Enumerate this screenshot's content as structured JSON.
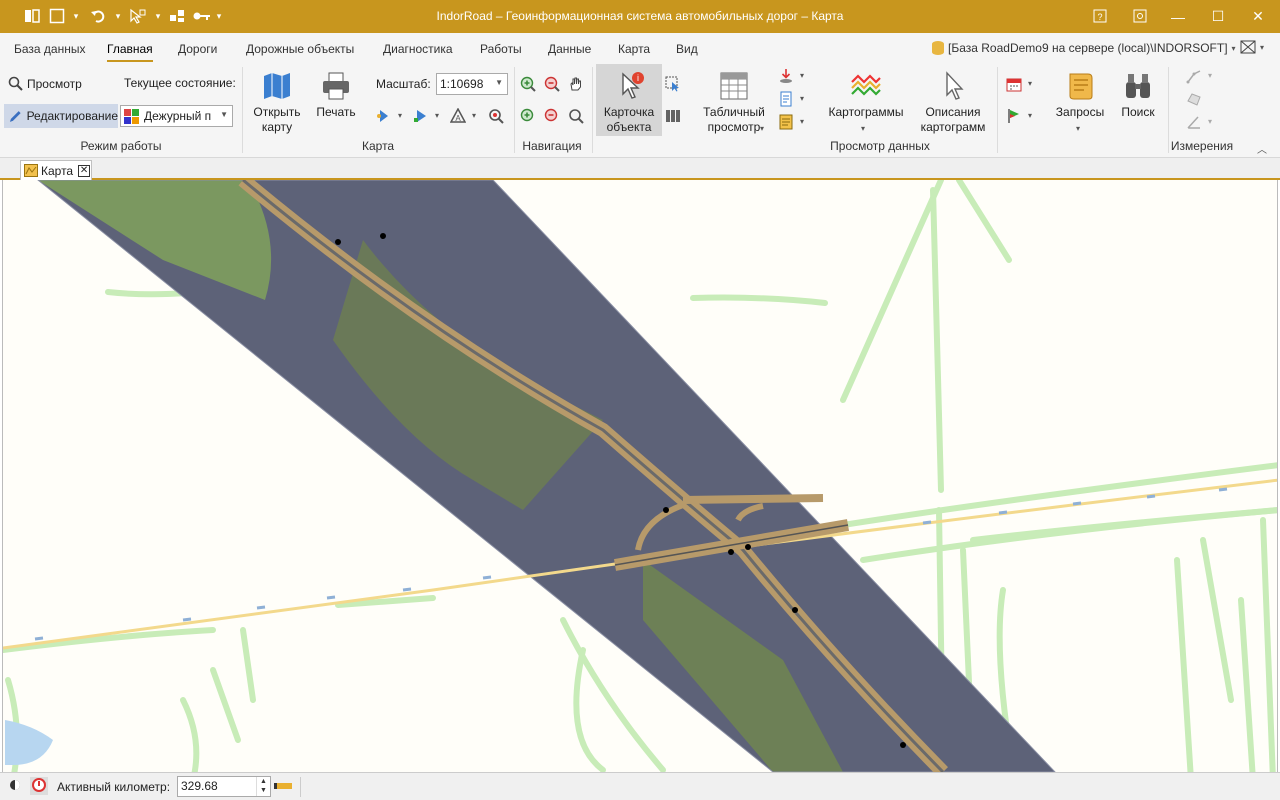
{
  "window": {
    "title": "IndorRoad – Геоинформационная система автомобильных дорог – Карта",
    "controls": {
      "minimize": "—",
      "maximize": "☐",
      "close": "✕"
    }
  },
  "menu_tabs": [
    {
      "label": "База данных"
    },
    {
      "label": "Главная"
    },
    {
      "label": "Дороги"
    },
    {
      "label": "Дорожные объекты"
    },
    {
      "label": "Диагностика"
    },
    {
      "label": "Работы"
    },
    {
      "label": "Данные"
    },
    {
      "label": "Карта"
    },
    {
      "label": "Вид"
    }
  ],
  "db_info": "[База RoadDemo9 на сервере (local)\\INDORSOFT]",
  "ribbon": {
    "mode_group": {
      "label": "Режим работы",
      "view": "Просмотр",
      "edit": "Редактирование",
      "state_label": "Текущее состояние:",
      "state_value": "Дежурный п"
    },
    "map_group": {
      "label": "Карта",
      "open_map_1": "Открыть",
      "open_map_2": "карту",
      "print": "Печать",
      "scale_label": "Масштаб:",
      "scale_value": "1:10698"
    },
    "nav_group": {
      "label": "Навигация"
    },
    "data_group": {
      "label": "Просмотр данных",
      "object_card_1": "Карточка",
      "object_card_2": "объекта",
      "table_view_1": "Табличный",
      "table_view_2": "просмотр",
      "cartograms": "Картограммы",
      "cartogram_desc_1": "Описания",
      "cartogram_desc_2": "картограмм",
      "queries": "Запросы",
      "search": "Поиск"
    },
    "measure_group": {
      "label": "Измерения"
    }
  },
  "doc_tab": {
    "label": "Карта"
  },
  "status": {
    "active_km_label": "Активный километр:",
    "active_km_value": "329.68"
  },
  "colors": {
    "accent": "#c8961e",
    "map_background": "#fffef9",
    "green_area": "#c8ecb8",
    "road_yellow": "#f5d98a",
    "imagery_dark": "#5a5f78",
    "imagery_green": "#7a9a5a"
  }
}
